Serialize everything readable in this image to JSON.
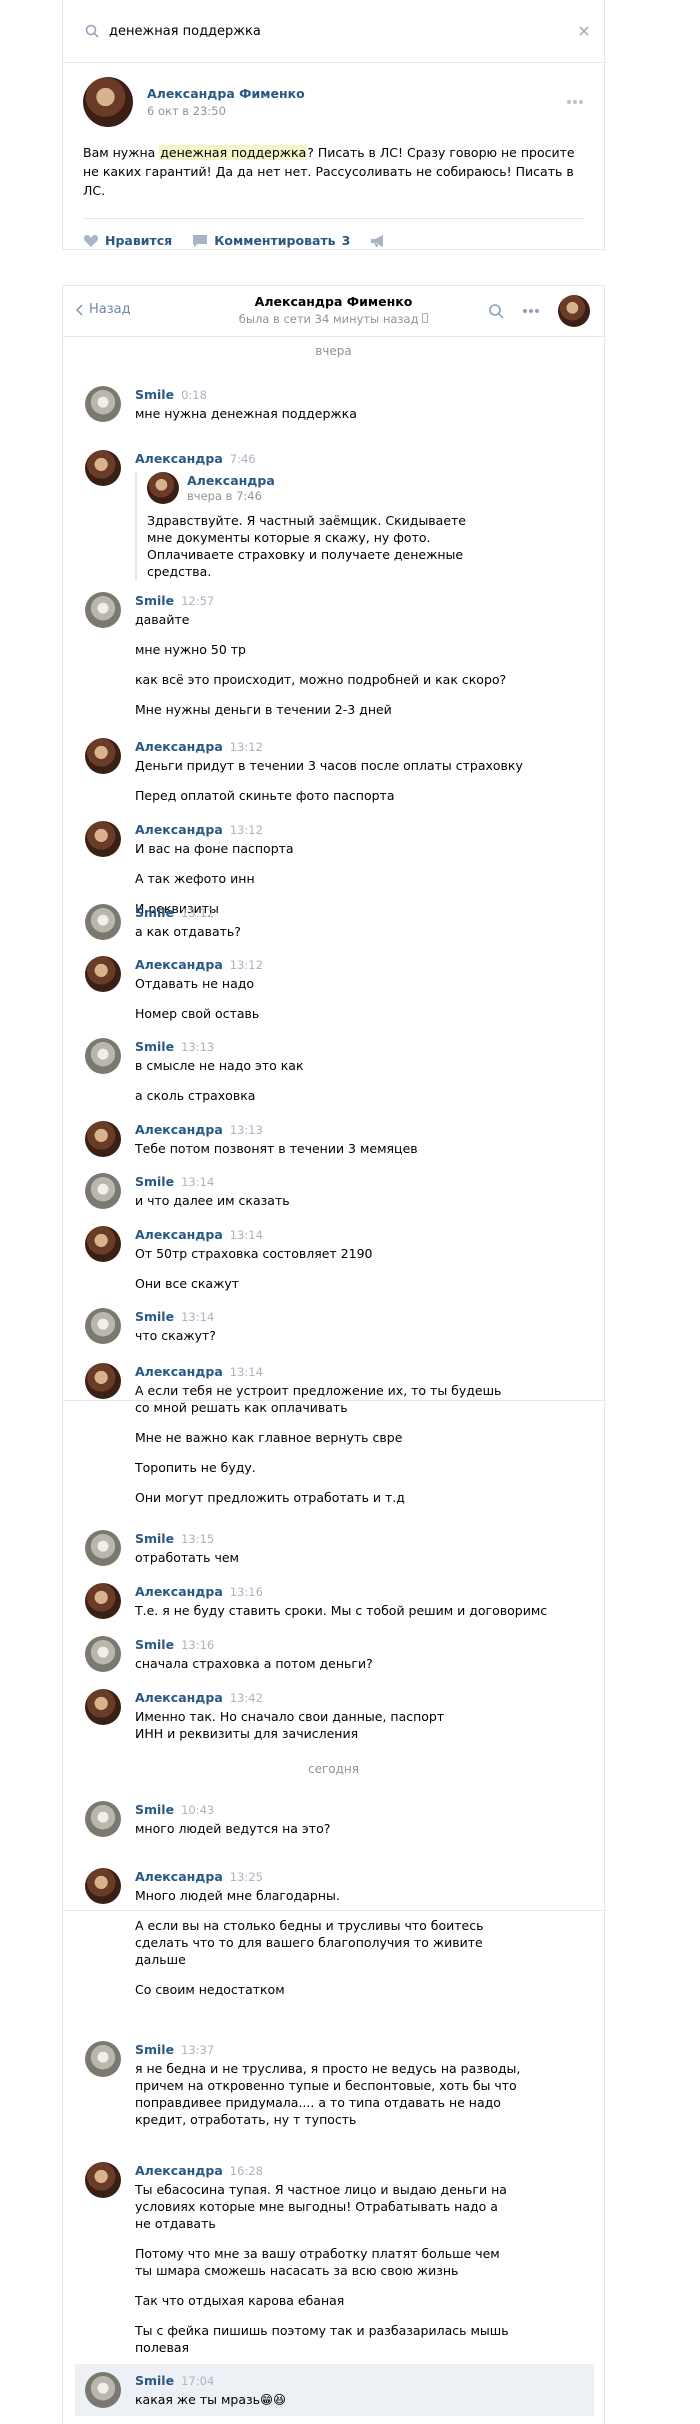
{
  "search": {
    "query": "денежная поддержка"
  },
  "post": {
    "author": "Александра Фименко",
    "date": "6 окт в 23:50",
    "text_before": "Вам нужна ",
    "text_highlight": "денежная поддержка",
    "text_after": "? Писать в ЛС! Сразу говорю не просите не каких гарантий! Да да нет нет. Рассусоливать не собираюсь! Писать в ЛС.",
    "like_label": "Нравится",
    "comment_label": "Комментировать",
    "comment_count": "3"
  },
  "chat": {
    "back_label": "Назад",
    "peer_name": "Александра Фименко",
    "peer_status": "была в сети 34 минуты назад",
    "day_yesterday": "вчера",
    "day_today": "сегодня",
    "messages": [
      {
        "author": "Smile",
        "time": "0:18",
        "texts": [
          "мне нужна денежная поддержка"
        ]
      },
      {
        "author": "Александра",
        "time": "7:46",
        "fwd_author": "Александра",
        "fwd_time": "вчера в 7:46",
        "fwd_text": "Здравствуйте. Я частный заёмщик. Скидываете мне документы которые я скажу, ну фото. Оплачиваете страховку и получаете денежные средства."
      },
      {
        "author": "Smile",
        "time": "12:57",
        "texts": [
          "давайте",
          "мне нужно 50 тр",
          "как всё это происходит, можно подробней и как скоро?",
          "Мне нужны деньги в течении 2-3 дней"
        ]
      },
      {
        "author": "Александра",
        "time": "13:12",
        "texts": [
          "Деньги придут в течении 3 часов после оплаты страховку",
          "Перед оплатой скиньте фото паспорта"
        ]
      },
      {
        "author": "Александра",
        "time": "13:12",
        "texts": [
          "И вас на фоне паспорта",
          "А так жефото инн",
          "И реквизиты"
        ]
      },
      {
        "author": "Smile",
        "time": "13:12",
        "texts": [
          "а как отдавать?"
        ]
      },
      {
        "author": "Александра",
        "time": "13:12",
        "texts": [
          "Отдавать не надо",
          "Номер свой оставь"
        ]
      },
      {
        "author": "Smile",
        "time": "13:13",
        "texts": [
          "в смысле не надо это как",
          "а сколь страховка"
        ]
      },
      {
        "author": "Александра",
        "time": "13:13",
        "texts": [
          "Тебе потом позвонят в течении 3 мемяцев"
        ]
      },
      {
        "author": "Smile",
        "time": "13:14",
        "texts": [
          "и что далее им сказать"
        ]
      },
      {
        "author": "Александра",
        "time": "13:14",
        "texts": [
          "От 50тр страховка состовляет 2190",
          "Они все скажут"
        ]
      },
      {
        "author": "Smile",
        "time": "13:14",
        "texts": [
          "что скажут?"
        ]
      },
      {
        "author": "Александра",
        "time": "13:14",
        "texts": [
          "А если тебя не устроит предложение их, то ты будешь со мной решать как оплачивать",
          "Мне не важно как главное вернуть свре",
          "Торопить не буду.",
          "Они могут предложить отработать и т.д"
        ]
      },
      {
        "author": "Smile",
        "time": "13:15",
        "texts": [
          "отработать чем"
        ]
      },
      {
        "author": "Александра",
        "time": "13:16",
        "texts": [
          "Т.е. я не буду ставить сроки. Мы с тобой решим и договоримс"
        ]
      },
      {
        "author": "Smile",
        "time": "13:16",
        "texts": [
          "сначала страховка а потом деньги?"
        ]
      },
      {
        "author": "Александра",
        "time": "13:42",
        "texts": [
          "Именно так. Но сначало свои данные, паспорт ИНН и реквизиты для зачисления"
        ]
      },
      {
        "author": "Smile",
        "time": "10:43",
        "texts": [
          "много людей ведутся на это?"
        ]
      },
      {
        "author": "Александра",
        "time": "13:25",
        "texts": [
          "Много людей мне благодарны.",
          "А если вы на столько бедны и трусливы что боитесь сделать что то для вашего благополучия то живите дальше",
          "Со своим недостатком"
        ]
      },
      {
        "author": "Smile",
        "time": "13:37",
        "texts": [
          "я не бедна и не труслива, я просто не ведусь на разводы, причем на откровенно тупые и беспонтовые, хоть бы что поправдивее придумала.... а то типа отдавать не надо кредит, отработать, ну т тупость"
        ]
      },
      {
        "author": "Александра",
        "time": "16:28",
        "texts": [
          "Ты ебасосина тупая. Я частное лицо и выдаю деньги на условиях которые мне выгодны! Отрабатывать надо а не отдавать",
          "Потому что мне за вашу отработку платят больше чем ты шмара сможешь насасать за всю свою жизнь",
          "Так что отдыхая карова ебаная",
          "Ты с фейка пишишь поэтому так и разбазарилась мышь полевая"
        ]
      },
      {
        "author": "Smile",
        "time": "17:04",
        "texts": [
          "какая же ты мразь😁😆"
        ]
      }
    ]
  }
}
